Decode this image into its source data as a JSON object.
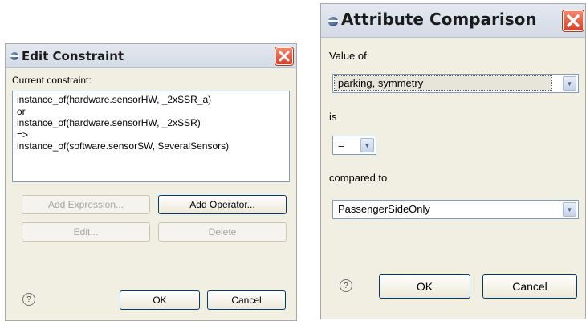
{
  "edit_constraint": {
    "title": "Edit Constraint",
    "current_label": "Current constraint:",
    "constraint_lines": [
      "instance_of(hardware.sensorHW, _2xSSR_a)",
      "or",
      "instance_of(hardware.sensorHW, _2xSSR)",
      "=>",
      "instance_of(software.sensorSW, SeveralSensors)"
    ],
    "buttons": {
      "add_expression": "Add Expression...",
      "add_operator": "Add Operator...",
      "edit": "Edit...",
      "delete": "Delete",
      "ok": "OK",
      "cancel": "Cancel"
    },
    "help": "?"
  },
  "attribute_comparison": {
    "title": "Attribute Comparison",
    "value_of_label": "Value of",
    "value_of_selected": "parking, symmetry",
    "is_label": "is",
    "operator_selected": "=",
    "compared_to_label": "compared to",
    "compared_to_selected": "PassengerSideOnly",
    "buttons": {
      "ok": "OK",
      "cancel": "Cancel"
    },
    "help": "?"
  },
  "icons": {
    "close": "close-icon",
    "help": "help-icon",
    "dropdown": "chevron-down-icon"
  }
}
